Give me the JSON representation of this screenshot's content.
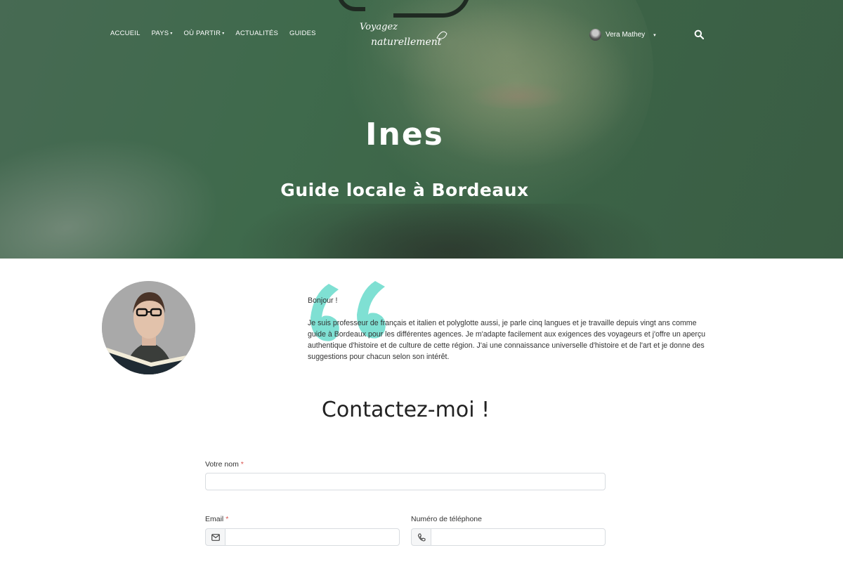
{
  "header": {
    "nav": [
      {
        "label": "ACCUEIL",
        "dropdown": false
      },
      {
        "label": "PAYS",
        "dropdown": true
      },
      {
        "label": "OÙ PARTIR",
        "dropdown": true
      },
      {
        "label": "ACTUALITÉS",
        "dropdown": false
      },
      {
        "label": "GUIDES",
        "dropdown": false
      }
    ],
    "logo": {
      "line1": "Voyagez",
      "line2": "naturellement"
    },
    "user": {
      "name": "Vera  Mathey"
    },
    "caret": "▾",
    "search_icon": "search-icon"
  },
  "hero": {
    "title": "Ines",
    "subtitle": "Guide locale à Bordeaux"
  },
  "profile": {
    "greeting": "Bonjour !",
    "bio": "Je suis professeur de français et italien et polyglotte aussi, je parle cinq langues et je travaille depuis vingt ans comme guide à Bordeaux pour les différentes agences. Je m'adapte facilement aux exigences des voyageurs et j'offre un aperçu authentique d'histoire et de culture de cette région. J'ai une connaissance universelle d'histoire et de l'art et je donne des suggestions pour chacun selon son intérêt.",
    "quote_color": "#7fe0d3"
  },
  "contact": {
    "title": "Contactez-moi !",
    "fields": {
      "name": {
        "label": "Votre nom",
        "required_mark": "*",
        "value": ""
      },
      "email": {
        "label": "Email",
        "required_mark": "*",
        "value": "",
        "icon": "envelope-icon"
      },
      "phone": {
        "label": "Numéro de téléphone",
        "value": "",
        "icon": "phone-icon"
      }
    }
  },
  "colors": {
    "hero_tint": "#3f6a4c",
    "required": "#d9534f",
    "accent_quote": "#7fe0d3"
  }
}
